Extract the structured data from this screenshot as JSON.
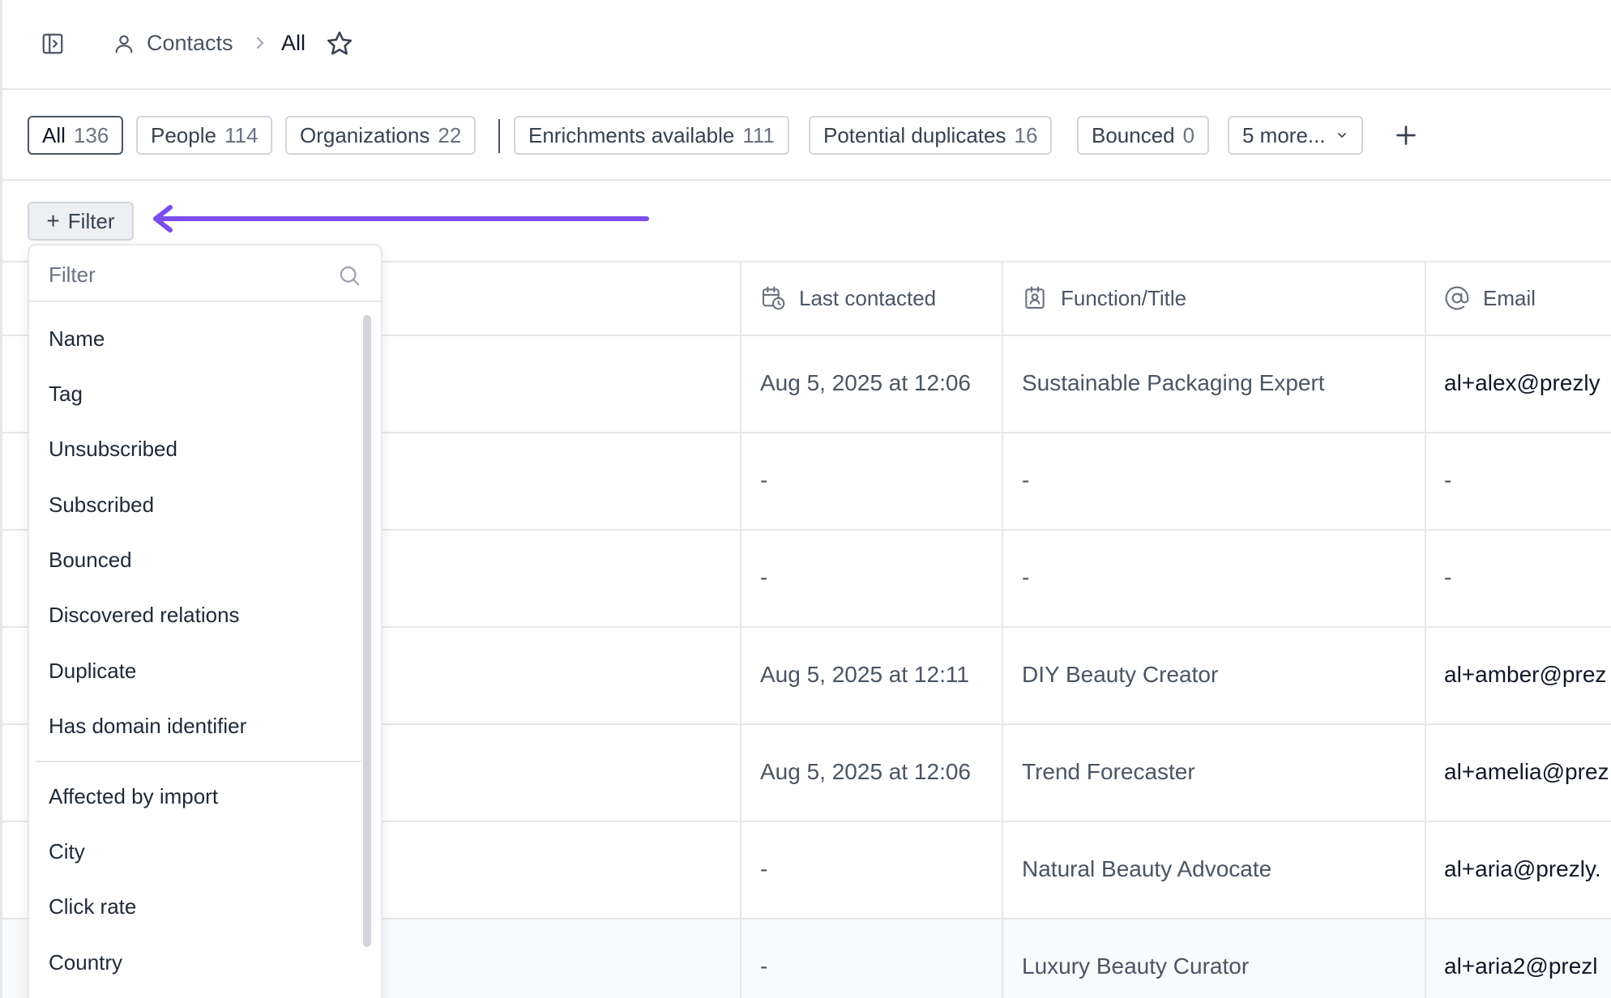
{
  "breadcrumb": {
    "section": "Contacts",
    "current": "All"
  },
  "tabs": [
    {
      "label": "All",
      "count": "136"
    },
    {
      "label": "People",
      "count": "114"
    },
    {
      "label": "Organizations",
      "count": "22"
    },
    {
      "label": "Enrichments available",
      "count": "111"
    },
    {
      "label": "Potential duplicates",
      "count": "16"
    },
    {
      "label": "Bounced",
      "count": "0"
    }
  ],
  "more_tabs_label": "5 more...",
  "filter_button_label": "Filter",
  "annotation_color": "#7c4dee",
  "table": {
    "columns": [
      "Last contacted",
      "Function/Title",
      "Email"
    ],
    "rows": [
      {
        "last_contacted": "Aug 5, 2025 at 12:06",
        "title": "Sustainable Packaging Expert",
        "email": "al+alex@prezly"
      },
      {
        "last_contacted": "-",
        "title": "-",
        "email": "-"
      },
      {
        "last_contacted": "-",
        "title": "-",
        "email": "-"
      },
      {
        "last_contacted": "Aug 5, 2025 at 12:11",
        "title": "DIY Beauty Creator",
        "email": "al+amber@prez"
      },
      {
        "last_contacted": "Aug 5, 2025 at 12:06",
        "title": "Trend Forecaster",
        "email": "al+amelia@prez"
      },
      {
        "last_contacted": "-",
        "title": "Natural Beauty Advocate",
        "email": "al+aria@prezly."
      },
      {
        "last_contacted": "-",
        "title": "Luxury Beauty Curator",
        "email": "al+aria2@prezl"
      }
    ]
  },
  "filter_dropdown": {
    "placeholder": "Filter",
    "items_primary": [
      "Name",
      "Tag",
      "Unsubscribed",
      "Subscribed",
      "Bounced",
      "Discovered relations",
      "Duplicate",
      "Has domain identifier"
    ],
    "items_secondary": [
      "Affected by import",
      "City",
      "Click rate",
      "Country"
    ]
  }
}
